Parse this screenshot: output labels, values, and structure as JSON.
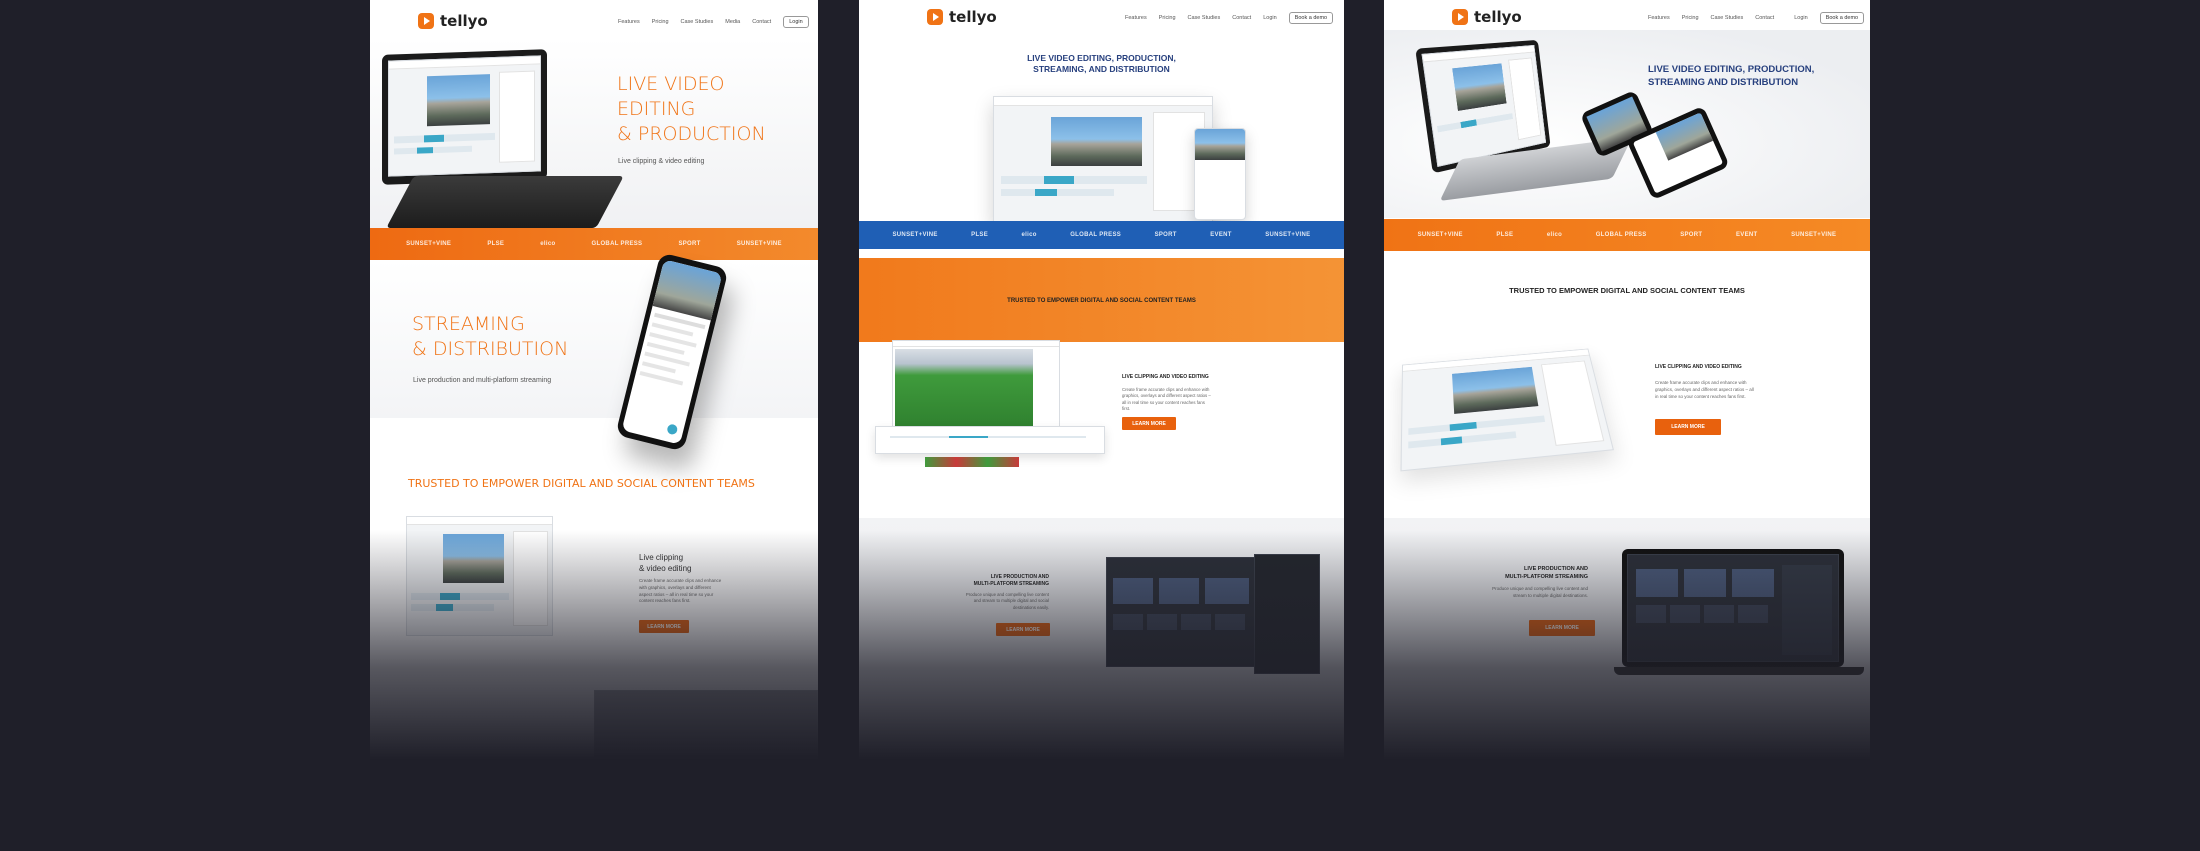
{
  "brand": {
    "name": "tellyo",
    "accent": "#f07315",
    "navy": "#27407e",
    "blue_band": "#1f5fb5"
  },
  "panels": [
    {
      "nav": {
        "items": [
          "Features",
          "Pricing",
          "Case Studies",
          "Media",
          "Contact"
        ],
        "cta": "Login"
      },
      "hero": {
        "line1": "LIVE VIDEO",
        "line2": "EDITING",
        "line3": "& PRODUCTION",
        "subtitle": "Live clipping & video editing"
      },
      "logos": [
        "SUNSET+VINE",
        "PLSE",
        "elico",
        "GLOBAL PRESS",
        "SPORT",
        "SUNSET+VINE"
      ],
      "streaming": {
        "line1": "STREAMING",
        "line2": "& DISTRIBUTION",
        "subtitle": "Live production and multi-platform streaming"
      },
      "trusted": "TRUSTED TO EMPOWER DIGITAL AND SOCIAL CONTENT TEAMS",
      "feature": {
        "line1": "Live clipping",
        "line2": "& video editing",
        "body": "Create frame accurate clips and enhance with graphics, overlays and different aspect ratios – all in real time so your content reaches fans first.",
        "button": "LEARN MORE"
      }
    },
    {
      "nav": {
        "items": [
          "Features",
          "Pricing",
          "Case Studies",
          "Contact"
        ],
        "login": "Login",
        "cta": "Book a demo"
      },
      "hero": {
        "line1": "LIVE VIDEO EDITING, PRODUCTION,",
        "line2": "STREAMING, AND DISTRIBUTION"
      },
      "logos": [
        "SUNSET+VINE",
        "PLSE",
        "elico",
        "GLOBAL PRESS",
        "SPORT",
        "EVENT",
        "SUNSET+VINE"
      ],
      "trusted": "TRUSTED TO EMPOWER DIGITAL AND SOCIAL CONTENT TEAMS",
      "feature": {
        "title": "LIVE CLIPPING AND VIDEO EDITING",
        "body": "Create frame accurate clips and enhance with graphics, overlays and different aspect ratios – all in real time so your content reaches fans first.",
        "button": "LEARN MORE"
      },
      "feature2": {
        "line1": "LIVE PRODUCTION AND",
        "line2": "MULTI-PLATFORM STREAMING",
        "body": "Produce unique and compelling live content and stream to multiple digital and social destinations easily.",
        "button": "LEARN MORE"
      }
    },
    {
      "nav": {
        "items": [
          "Features",
          "Pricing",
          "Case Studies",
          "Contact"
        ],
        "login": "Login",
        "cta": "Book a demo"
      },
      "hero": {
        "line1": "LIVE VIDEO EDITING, PRODUCTION,",
        "line2": "STREAMING AND DISTRIBUTION"
      },
      "logos": [
        "SUNSET+VINE",
        "PLSE",
        "elico",
        "GLOBAL PRESS",
        "SPORT",
        "EVENT",
        "SUNSET+VINE"
      ],
      "trusted": "TRUSTED TO EMPOWER DIGITAL AND SOCIAL CONTENT TEAMS",
      "feature": {
        "title": "LIVE CLIPPING AND VIDEO EDITING",
        "body": "Create frame accurate clips and enhance with graphics, overlays and different aspect ratios – all in real time so your content reaches fans first.",
        "button": "LEARN MORE"
      },
      "feature2": {
        "line1": "LIVE PRODUCTION AND",
        "line2": "MULTI-PLATFORM STREAMING",
        "body": "Produce unique and compelling live content and stream to multiple digital destinations.",
        "button": "LEARN MORE"
      }
    }
  ]
}
